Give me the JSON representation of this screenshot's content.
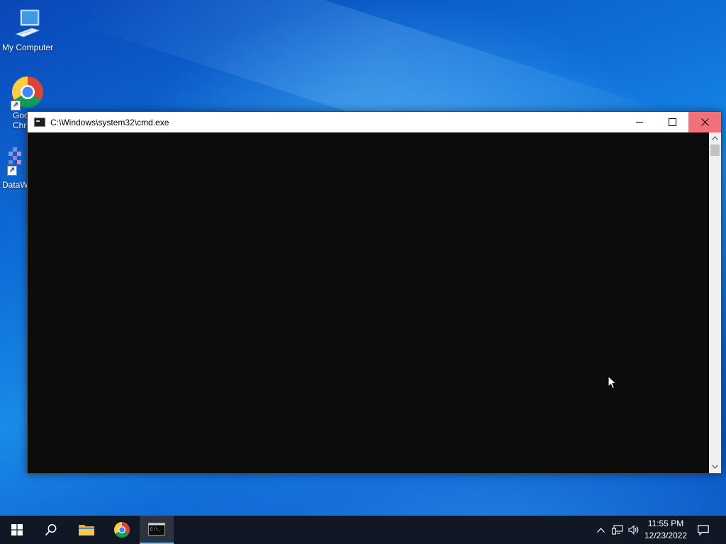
{
  "desktop": {
    "icons": [
      {
        "label": "My Computer",
        "icon": "computer-icon"
      },
      {
        "label": "Goo\nChr",
        "icon": "chrome-icon"
      },
      {
        "label": "DataW",
        "icon": "datawrapper-icon"
      }
    ]
  },
  "cmd_window": {
    "title": "C:\\Windows\\system32\\cmd.exe",
    "icon": "cmd-icon",
    "console_text": "",
    "buttons": {
      "minimize": "minimize-icon",
      "maximize": "maximize-icon",
      "close": "close-icon"
    },
    "colors": {
      "console_bg": "#0c0c0c",
      "close_hover": "#f1707a"
    }
  },
  "taskbar": {
    "pinned": [
      {
        "name": "start",
        "icon": "windows-logo-icon"
      },
      {
        "name": "search",
        "icon": "search-icon"
      },
      {
        "name": "file-explorer",
        "icon": "folder-icon"
      },
      {
        "name": "chrome",
        "icon": "chrome-icon"
      },
      {
        "name": "cmd",
        "icon": "cmd-icon",
        "active": true
      }
    ],
    "tray": {
      "icons": [
        "chevron-up-icon",
        "network-icon",
        "volume-icon"
      ],
      "time": "11:55 PM",
      "date": "12/23/2022",
      "notification_icon": "notification-icon"
    }
  }
}
